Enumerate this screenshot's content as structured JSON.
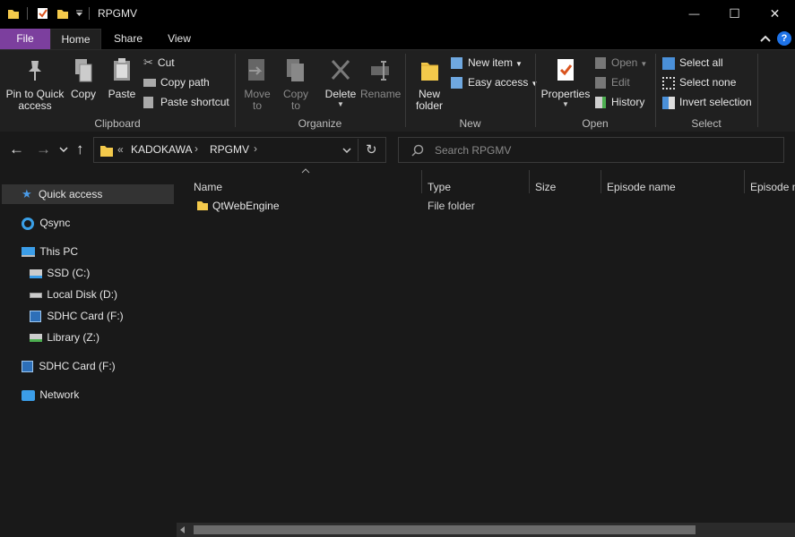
{
  "window": {
    "title": "RPGMV",
    "controls": {
      "minimize": "—",
      "maximize": "☐",
      "close": "✕"
    }
  },
  "tabs": [
    {
      "label": "File"
    },
    {
      "label": "Home"
    },
    {
      "label": "Share"
    },
    {
      "label": "View"
    }
  ],
  "ribbon": {
    "clipboard": {
      "group_label": "Clipboard",
      "pin_label": "Pin to Quick access",
      "copy_label": "Copy",
      "paste_label": "Paste",
      "cut_label": "Cut",
      "copy_path_label": "Copy path",
      "paste_shortcut_label": "Paste shortcut"
    },
    "organize": {
      "group_label": "Organize",
      "move_to_label": "Move to",
      "copy_to_label": "Copy to",
      "delete_label": "Delete",
      "rename_label": "Rename"
    },
    "new": {
      "group_label": "New",
      "new_folder_label": "New folder",
      "new_item_label": "New item",
      "easy_access_label": "Easy access"
    },
    "open": {
      "group_label": "Open",
      "properties_label": "Properties",
      "open_label": "Open",
      "edit_label": "Edit",
      "history_label": "History"
    },
    "select": {
      "group_label": "Select",
      "select_all_label": "Select all",
      "select_none_label": "Select none",
      "invert_label": "Invert selection"
    }
  },
  "address": {
    "overflow": "«",
    "crumbs": [
      "KADOKAWA",
      "RPGMV"
    ],
    "search_placeholder": "Search RPGMV"
  },
  "nav": {
    "items": [
      {
        "label": "Quick access",
        "icon": "star-icon"
      },
      {
        "label": "Qsync",
        "icon": "qsync-icon"
      },
      {
        "label": "This PC",
        "icon": "pc-icon"
      },
      {
        "label": "SSD (C:)",
        "icon": "drive-icon"
      },
      {
        "label": "Local Disk (D:)",
        "icon": "drive-icon"
      },
      {
        "label": "SDHC Card (F:)",
        "icon": "sdcard-icon"
      },
      {
        "label": "Library (Z:)",
        "icon": "network-drive-icon"
      },
      {
        "label": "SDHC Card (F:)",
        "icon": "sdcard-icon"
      },
      {
        "label": "Network",
        "icon": "network-icon"
      }
    ]
  },
  "columns": [
    "Name",
    "Type",
    "Size",
    "Episode name",
    "Episode n"
  ],
  "files": [
    {
      "name": "QtWebEngine",
      "type": "File folder"
    }
  ],
  "colors": {
    "accent_file_tab": "#7c3f9e",
    "help_icon": "#1e73e8"
  }
}
